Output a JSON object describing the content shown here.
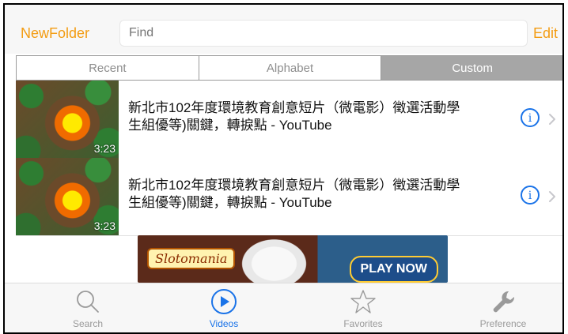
{
  "header": {
    "new_folder_label": "NewFolder",
    "search_placeholder": "Find",
    "edit_label": "Edit"
  },
  "segmented": {
    "items": [
      {
        "label": "Recent",
        "active": false
      },
      {
        "label": "Alphabet",
        "active": false
      },
      {
        "label": "Custom",
        "active": true
      }
    ]
  },
  "list": {
    "rows": [
      {
        "title": "新北市102年度環境教育創意短片（微電影）徵選活動學生組優等)關鍵，轉捩點 - YouTube",
        "duration": "3:23",
        "info_icon": "info-icon",
        "chevron_icon": "chevron-right-icon"
      },
      {
        "title": "新北市102年度環境教育創意短片（微電影）徵選活動學生組優等)關鍵，轉捩點 - YouTube",
        "duration": "3:23",
        "info_icon": "info-icon",
        "chevron_icon": "chevron-right-icon"
      }
    ]
  },
  "ad": {
    "logo_text": "Slotomania",
    "cta_text": "PLAY NOW"
  },
  "tabbar": {
    "items": [
      {
        "label": "Search",
        "icon": "search-icon",
        "active": false
      },
      {
        "label": "Videos",
        "icon": "play-icon",
        "active": true
      },
      {
        "label": "Favorites",
        "icon": "star-icon",
        "active": false
      },
      {
        "label": "Preference",
        "icon": "wrench-icon",
        "active": false
      }
    ]
  },
  "colors": {
    "accent": "#f39c12",
    "active_tab": "#1a73e8",
    "segmented_active": "#a6a6a6"
  }
}
